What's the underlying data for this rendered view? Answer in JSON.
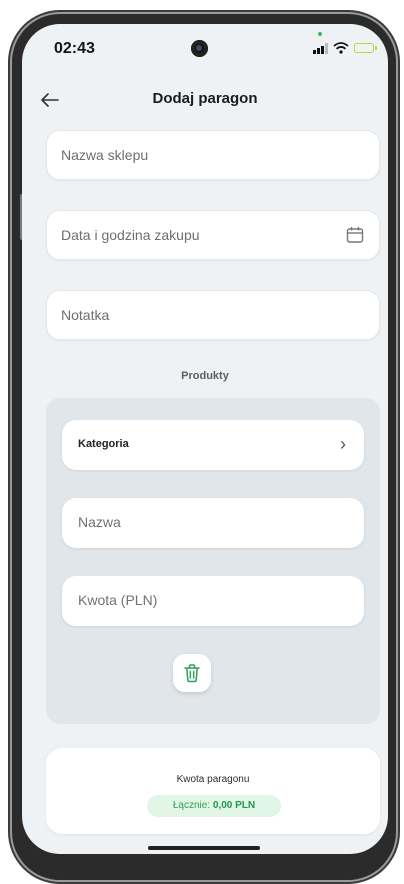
{
  "status_bar": {
    "time": "02:43"
  },
  "header": {
    "title": "Dodaj paragon"
  },
  "form": {
    "store_placeholder": "Nazwa sklepu",
    "datetime_placeholder": "Data i godzina zakupu",
    "note_placeholder": "Notatka"
  },
  "products": {
    "section_label": "Produkty",
    "category_label": "Kategoria",
    "name_placeholder": "Nazwa",
    "amount_placeholder": "Kwota (PLN)"
  },
  "summary": {
    "title": "Kwota paragonu",
    "total_prefix": "Łącznie: ",
    "total_value": "0,00 PLN"
  },
  "colors": {
    "accent_green": "#2fa057",
    "background": "#eef2f4"
  }
}
